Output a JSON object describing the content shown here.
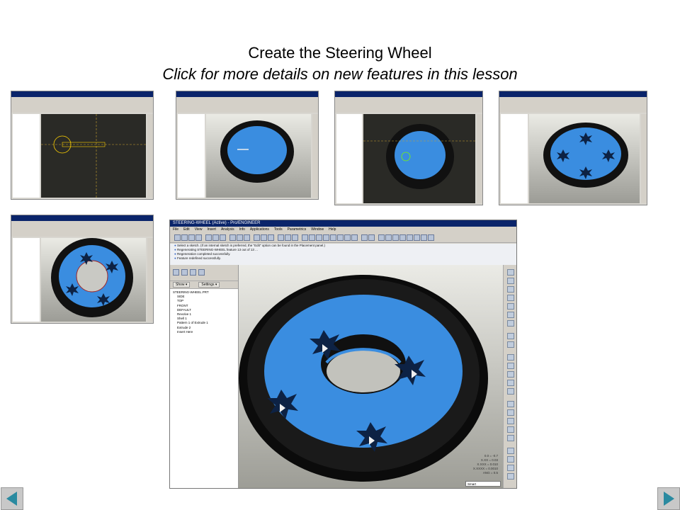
{
  "heading": {
    "title": "Create the Steering Wheel",
    "link_text": "Click for more details on new features in this lesson"
  },
  "thumbnails": [
    {
      "name": "step1-sketch",
      "view": "sketch"
    },
    {
      "name": "step2-revolve",
      "view": "ring"
    },
    {
      "name": "step3-sketch-on-ring",
      "view": "ring-sketch"
    },
    {
      "name": "step4-stars",
      "view": "ring-stars"
    },
    {
      "name": "step5-hole",
      "view": "ring-hole"
    }
  ],
  "large_screenshot": {
    "window_title": "STEERING-WHEEL (Active) - Pro/ENGINEER",
    "menu": [
      "File",
      "Edit",
      "View",
      "Insert",
      "Analysis",
      "Info",
      "Applications",
      "Tools",
      "Parametrics",
      "Window",
      "Help"
    ],
    "messages": [
      "Select a sketch. (If an internal sketch is preferred, the \"Edit\" option can be found in the Placement panel.)",
      "Regenerating STEERING-WHEEL feature 13 out of 13 ...",
      "Regeneration completed successfully.",
      "Feature redefined successfully."
    ],
    "tabs": {
      "show": "Show ▾",
      "settings": "Settings ▾"
    },
    "model_tree": {
      "root": "STEERING-WHEEL.PRT",
      "items": [
        "SIDE",
        "TOP",
        "FRONT",
        "DEFAULT",
        "Revolve 1",
        "Shell 1",
        "Pattern 1 of Extrude 1",
        "Extrude 2",
        "Insert Here"
      ]
    },
    "coords": [
      "0.0 = -0.7",
      "X.XX = 0.03",
      "X.XXX = 0.010",
      "X.XXXX = 0.0010",
      "ANG = 0.5"
    ],
    "filter": "Smart"
  },
  "nav": {
    "prev_icon": "arrow-left-icon",
    "next_icon": "arrow-right-icon"
  },
  "colors": {
    "accent_blue": "#3a8de0",
    "tire": "#111111",
    "viewport_dark": "#2a2a26",
    "nav_arrow": "#2a8aa0"
  }
}
